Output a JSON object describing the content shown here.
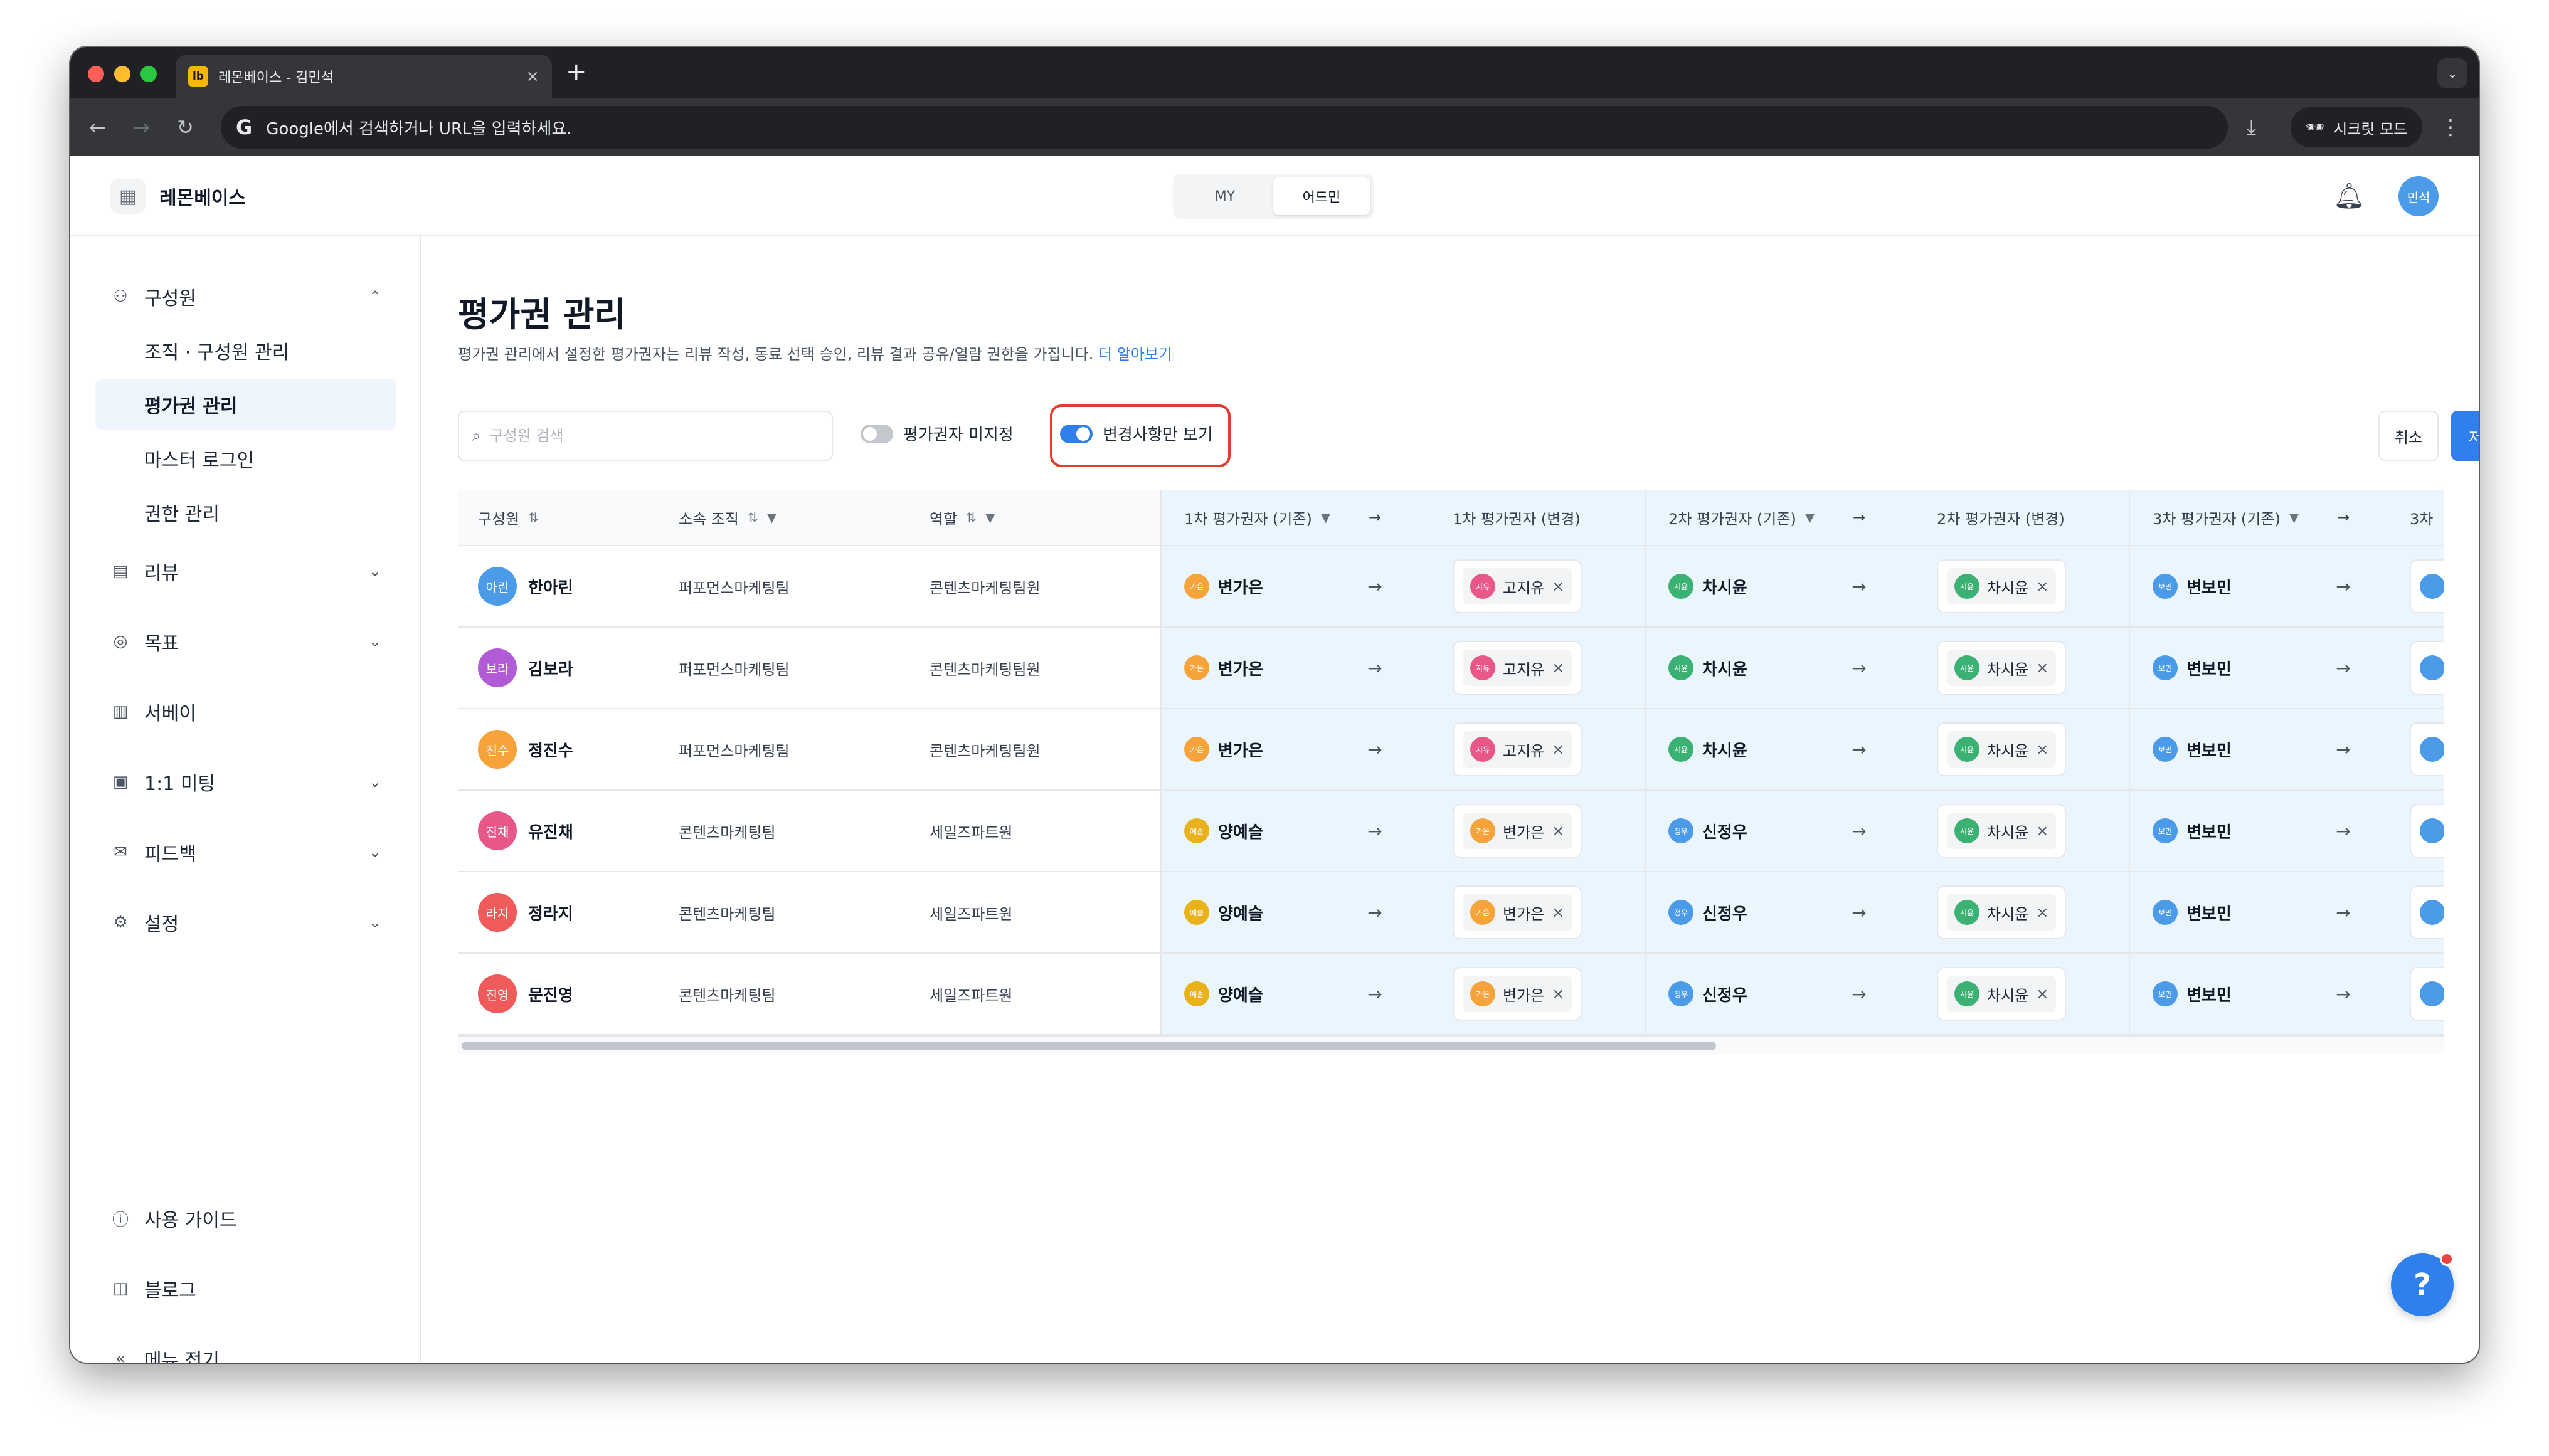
{
  "browser": {
    "tab_title": "레몬베이스 - 김민석",
    "favicon_text": "lb",
    "new_tab_icon": "plus-icon",
    "address_placeholder": "Google에서 검색하거나 URL을 입력하세요.",
    "incognito_label": "시크릿 모드"
  },
  "header": {
    "brand": "레몬베이스",
    "modes": [
      "MY",
      "어드민"
    ],
    "active_mode": "어드민",
    "user_initials": "민석"
  },
  "sidebar": {
    "sections": [
      {
        "label": "구성원",
        "icon": "person-icon",
        "expanded": true,
        "items": [
          "조직 · 구성원 관리",
          "평가권 관리",
          "마스터 로그인",
          "권한 관리"
        ]
      },
      {
        "label": "리뷰",
        "icon": "document-icon"
      },
      {
        "label": "목표",
        "icon": "target-icon"
      },
      {
        "label": "서베이",
        "icon": "chart-icon"
      },
      {
        "label": "1:1 미팅",
        "icon": "calendar-icon"
      },
      {
        "label": "피드백",
        "icon": "mail-icon"
      },
      {
        "label": "설정",
        "icon": "gear-icon"
      }
    ],
    "active_item": "평가권 관리",
    "bottom": [
      {
        "label": "사용 가이드",
        "icon": "question-icon"
      },
      {
        "label": "블로그",
        "icon": "book-icon"
      },
      {
        "label": "메뉴 접기",
        "icon": "collapse-icon"
      }
    ]
  },
  "page": {
    "title": "평가권 관리",
    "description": "평가권 관리에서 설정한 평가권자는 리뷰 작성, 동료 선택 승인, 리뷰 결과 공유/열람 권한을 가집니다.",
    "learn_more": "더 알아보기",
    "search_placeholder": "구성원 검색",
    "toggle_unassigned": {
      "label": "평가권자 미지정",
      "on": false
    },
    "toggle_changes_only": {
      "label": "변경사항만 보기",
      "on": true
    },
    "cancel": "취소",
    "save": "저장"
  },
  "table": {
    "columns": [
      "구성원",
      "소속 조직",
      "역할",
      "1차 평가권자 (기존)",
      "1차 평가권자 (변경)",
      "2차 평가권자 (기존)",
      "2차 평가권자 (변경)",
      "3차 평가권자 (기존)",
      "3차"
    ],
    "rows": [
      {
        "initials": "아린",
        "name": "한아린",
        "color": "#4b9be8",
        "org": "퍼포먼스마케팅팀",
        "role": "콘텐츠마케팅팀원",
        "e1_old": {
          "n": "변가은",
          "i": "가은",
          "c": "#f5a33a"
        },
        "e1_new": {
          "n": "고지유",
          "i": "지유",
          "c": "#e8578a"
        },
        "e2_old": {
          "n": "차시윤",
          "i": "시윤",
          "c": "#3bb273"
        },
        "e2_new": {
          "n": "차시윤",
          "i": "시윤",
          "c": "#3bb273"
        },
        "e3_old": {
          "n": "변보민",
          "i": "보민",
          "c": "#4b9be8"
        }
      },
      {
        "initials": "보라",
        "name": "김보라",
        "color": "#b25bd6",
        "org": "퍼포먼스마케팅팀",
        "role": "콘텐츠마케팅팀원",
        "e1_old": {
          "n": "변가은",
          "i": "가은",
          "c": "#f5a33a"
        },
        "e1_new": {
          "n": "고지유",
          "i": "지유",
          "c": "#e8578a"
        },
        "e2_old": {
          "n": "차시윤",
          "i": "시윤",
          "c": "#3bb273"
        },
        "e2_new": {
          "n": "차시윤",
          "i": "시윤",
          "c": "#3bb273"
        },
        "e3_old": {
          "n": "변보민",
          "i": "보민",
          "c": "#4b9be8"
        }
      },
      {
        "initials": "진수",
        "name": "정진수",
        "color": "#f5a33a",
        "org": "퍼포먼스마케팅팀",
        "role": "콘텐츠마케팅팀원",
        "e1_old": {
          "n": "변가은",
          "i": "가은",
          "c": "#f5a33a"
        },
        "e1_new": {
          "n": "고지유",
          "i": "지유",
          "c": "#e8578a"
        },
        "e2_old": {
          "n": "차시윤",
          "i": "시윤",
          "c": "#3bb273"
        },
        "e2_new": {
          "n": "차시윤",
          "i": "시윤",
          "c": "#3bb273"
        },
        "e3_old": {
          "n": "변보민",
          "i": "보민",
          "c": "#4b9be8"
        }
      },
      {
        "initials": "진채",
        "name": "유진채",
        "color": "#e8578a",
        "org": "콘텐츠마케팅팀",
        "role": "세일즈파트원",
        "e1_old": {
          "n": "양예슬",
          "i": "예슬",
          "c": "#e9b21c"
        },
        "e1_new": {
          "n": "변가은",
          "i": "가은",
          "c": "#f5a33a"
        },
        "e2_old": {
          "n": "신정우",
          "i": "정우",
          "c": "#4b9be8"
        },
        "e2_new": {
          "n": "차시윤",
          "i": "시윤",
          "c": "#3bb273"
        },
        "e3_old": {
          "n": "변보민",
          "i": "보민",
          "c": "#4b9be8"
        }
      },
      {
        "initials": "라지",
        "name": "정라지",
        "color": "#ef5a5a",
        "org": "콘텐츠마케팅팀",
        "role": "세일즈파트원",
        "e1_old": {
          "n": "양예슬",
          "i": "예슬",
          "c": "#e9b21c"
        },
        "e1_new": {
          "n": "변가은",
          "i": "가은",
          "c": "#f5a33a"
        },
        "e2_old": {
          "n": "신정우",
          "i": "정우",
          "c": "#4b9be8"
        },
        "e2_new": {
          "n": "차시윤",
          "i": "시윤",
          "c": "#3bb273"
        },
        "e3_old": {
          "n": "변보민",
          "i": "보민",
          "c": "#4b9be8"
        }
      },
      {
        "initials": "진영",
        "name": "문진영",
        "color": "#ef5a5a",
        "org": "콘텐츠마케팅팀",
        "role": "세일즈파트원",
        "e1_old": {
          "n": "양예슬",
          "i": "예슬",
          "c": "#e9b21c"
        },
        "e1_new": {
          "n": "변가은",
          "i": "가은",
          "c": "#f5a33a"
        },
        "e2_old": {
          "n": "신정우",
          "i": "정우",
          "c": "#4b9be8"
        },
        "e2_new": {
          "n": "차시윤",
          "i": "시윤",
          "c": "#3bb273"
        },
        "e3_old": {
          "n": "변보민",
          "i": "보민",
          "c": "#4b9be8"
        }
      }
    ]
  },
  "colors": {
    "accent": "#2f80ed",
    "highlight": "#e53a2f",
    "tint": "#eaf5fd"
  }
}
